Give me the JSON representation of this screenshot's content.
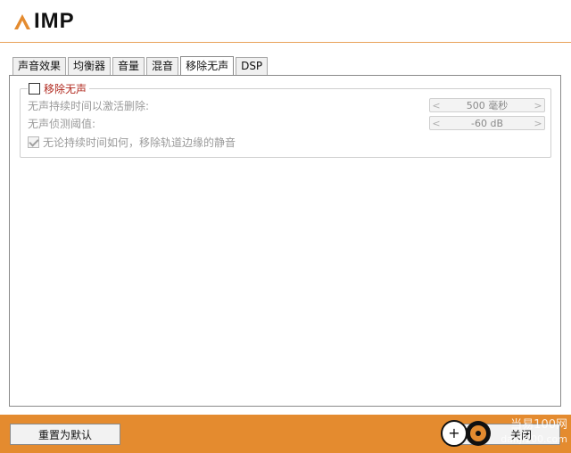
{
  "app": {
    "logo_text": "IMP"
  },
  "tabs": [
    {
      "label": "声音效果"
    },
    {
      "label": "均衡器"
    },
    {
      "label": "音量"
    },
    {
      "label": "混音"
    },
    {
      "label": "移除无声",
      "active": true
    },
    {
      "label": "DSP"
    }
  ],
  "silence": {
    "enable_label": "移除无声",
    "enabled": false,
    "duration_label": "无声持续时间以激活删除:",
    "duration_value": "500 毫秒",
    "threshold_label": "无声侦测阈值:",
    "threshold_value": "-60 dB",
    "edges_label": "无论持续时间如何，移除轨道边缘的静音",
    "edges_checked": true
  },
  "footer": {
    "reset_label": "重置为默认",
    "close_label": "关闭",
    "watermark_line1": "当易100网",
    "watermark_line2": "danji100.com"
  },
  "colors": {
    "accent": "#e48b2f",
    "legend_text": "#b0281e"
  }
}
